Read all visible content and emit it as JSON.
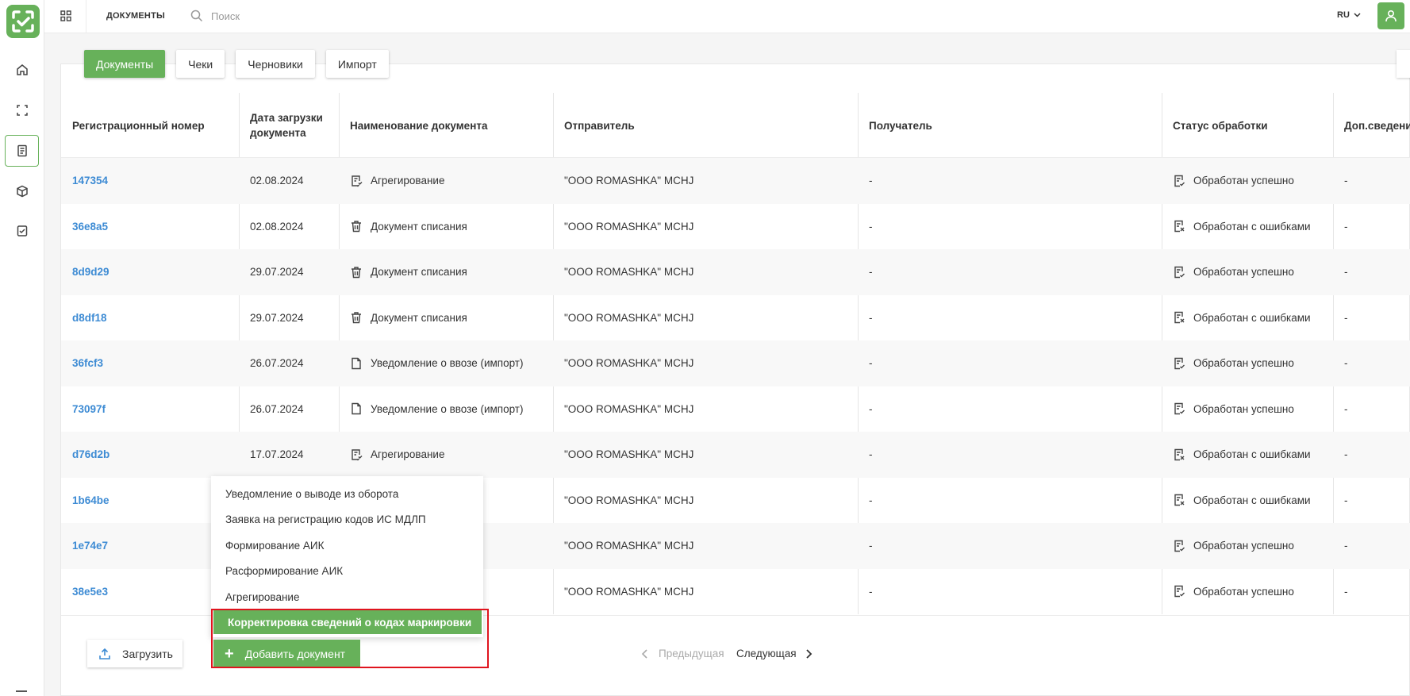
{
  "header": {
    "page_label": "ДОКУМЕНТЫ",
    "search_placeholder": "Поиск",
    "language": "RU"
  },
  "tabs": [
    {
      "label": "Документы",
      "active": true
    },
    {
      "label": "Чеки",
      "active": false
    },
    {
      "label": "Черновики",
      "active": false
    },
    {
      "label": "Импорт",
      "active": false
    }
  ],
  "table": {
    "columns": [
      "Регистрационный номер",
      "Дата загрузки документа",
      "Наименование документа",
      "Отправитель",
      "Получатель",
      "Статус обработки",
      "Доп.сведени"
    ],
    "rows": [
      {
        "reg": "147354",
        "date": "02.08.2024",
        "name": "Агрегирование",
        "name_icon": "aggregation-icon",
        "sender": "\"OOO ROMASHKA\" MCHJ",
        "receiver": "-",
        "status": "Обработан успешно",
        "status_icon": "status-success-icon",
        "extra": "-"
      },
      {
        "reg": "36e8a5",
        "date": "02.08.2024",
        "name": "Документ списания",
        "name_icon": "trash-icon",
        "sender": "\"OOO ROMASHKA\" MCHJ",
        "receiver": "-",
        "status": "Обработан с ошибками",
        "status_icon": "status-error-icon",
        "extra": "-"
      },
      {
        "reg": "8d9d29",
        "date": "29.07.2024",
        "name": "Документ списания",
        "name_icon": "trash-icon",
        "sender": "\"OOO ROMASHKA\" MCHJ",
        "receiver": "-",
        "status": "Обработан успешно",
        "status_icon": "status-success-icon",
        "extra": "-"
      },
      {
        "reg": "d8df18",
        "date": "29.07.2024",
        "name": "Документ списания",
        "name_icon": "trash-icon",
        "sender": "\"OOO ROMASHKA\" MCHJ",
        "receiver": "-",
        "status": "Обработан с ошибками",
        "status_icon": "status-error-icon",
        "extra": "-"
      },
      {
        "reg": "36fcf3",
        "date": "26.07.2024",
        "name": "Уведомление о ввозе (импорт)",
        "name_icon": "document-icon",
        "sender": "\"OOO ROMASHKA\" MCHJ",
        "receiver": "-",
        "status": "Обработан успешно",
        "status_icon": "status-success-icon",
        "extra": "-"
      },
      {
        "reg": "73097f",
        "date": "26.07.2024",
        "name": "Уведомление о ввозе (импорт)",
        "name_icon": "document-icon",
        "sender": "\"OOO ROMASHKA\" MCHJ",
        "receiver": "-",
        "status": "Обработан успешно",
        "status_icon": "status-success-icon",
        "extra": "-"
      },
      {
        "reg": "d76d2b",
        "date": "17.07.2024",
        "name": "Агрегирование",
        "name_icon": "aggregation-icon",
        "sender": "\"OOO ROMASHKA\" MCHJ",
        "receiver": "-",
        "status": "Обработан с ошибками",
        "status_icon": "status-error-icon",
        "extra": "-"
      },
      {
        "reg": "1b64be",
        "date": "",
        "name": "",
        "name_icon": "",
        "sender": "\"OOO ROMASHKA\" MCHJ",
        "receiver": "-",
        "status": "Обработан с ошибками",
        "status_icon": "status-error-icon",
        "extra": "-"
      },
      {
        "reg": "1e74e7",
        "date": "",
        "name": "",
        "name_icon": "",
        "sender": "\"OOO ROMASHKA\" MCHJ",
        "receiver": "-",
        "status": "Обработан успешно",
        "status_icon": "status-success-icon",
        "extra": "-"
      },
      {
        "reg": "38e5e3",
        "date": "",
        "name": "",
        "name_icon": "",
        "sender": "\"OOO ROMASHKA\" MCHJ",
        "receiver": "-",
        "status": "Обработан успешно",
        "status_icon": "status-success-icon",
        "extra": "-"
      }
    ]
  },
  "dropdown": {
    "items": [
      "Уведомление о выводе из оборота",
      "Заявка на регистрацию кодов ИС МДЛП",
      "Формирование АИК",
      "Расформирование АИК",
      "Агрегирование",
      "Корректировка сведений о кодах маркировки"
    ],
    "highlighted_index": 5
  },
  "footer": {
    "upload_label": "Загрузить",
    "add_label": "Добавить документ",
    "prev_label": "Предыдущая",
    "next_label": "Следующая"
  },
  "colors": {
    "accent": "#67b15a",
    "link": "#3d8bd4",
    "highlight_frame": "#e0141e"
  }
}
